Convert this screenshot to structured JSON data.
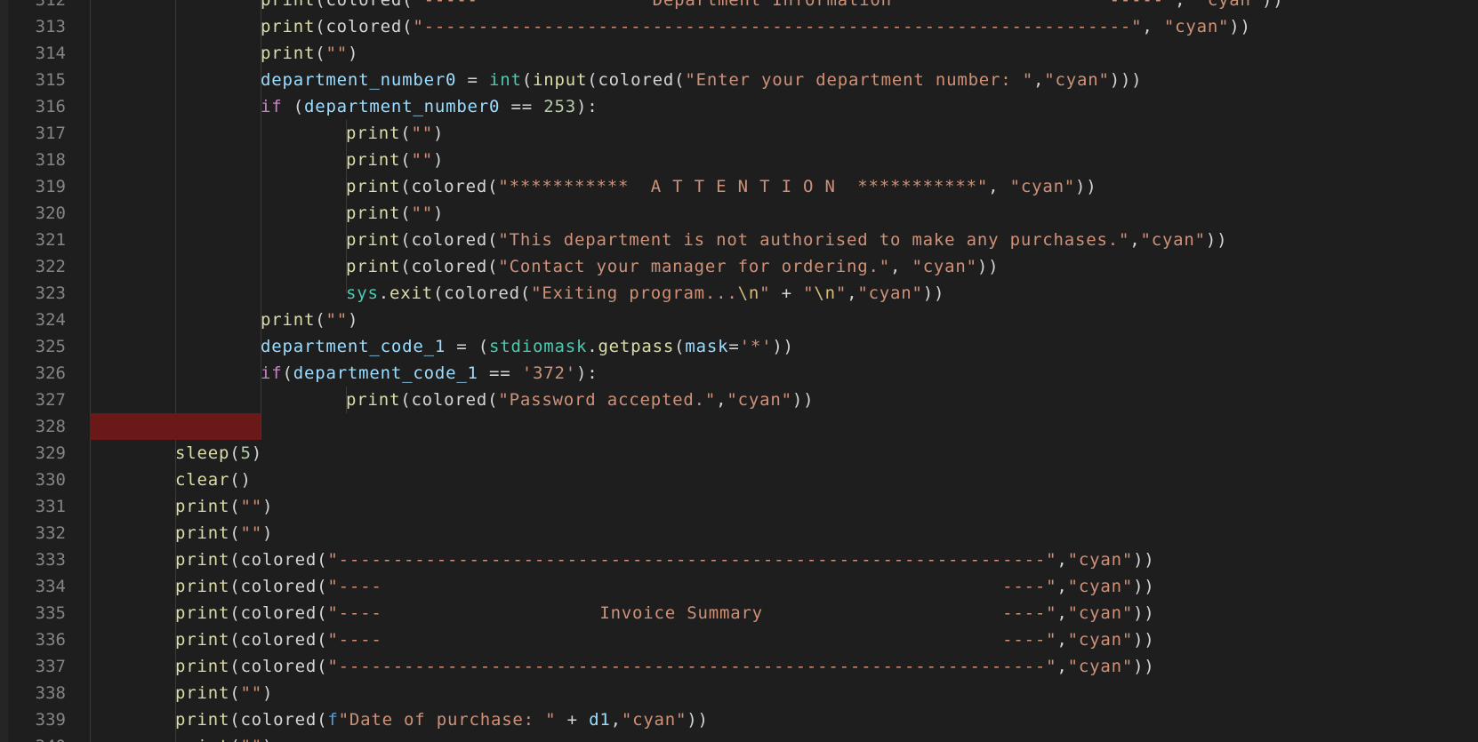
{
  "editor": {
    "colors": {
      "background": "#1e1e1e",
      "line_number": "#858585",
      "string": "#ce9178",
      "keyword": "#c586c0",
      "variable": "#9cdcfe",
      "function": "#dcdcaa",
      "type": "#4ec9b0",
      "number": "#b5cea8",
      "error_highlight": "#6b1818"
    },
    "lines": [
      {
        "num": "312",
        "indent": 8,
        "tokens": [
          [
            "f",
            "print"
          ],
          [
            "p",
            "(colored("
          ],
          [
            "s",
            "\"-----                Department Information                    -----\""
          ],
          [
            "p",
            ", "
          ],
          [
            "s",
            "\"cyan\""
          ],
          [
            "p",
            "))"
          ]
        ]
      },
      {
        "num": "313",
        "indent": 8,
        "tokens": [
          [
            "f",
            "print"
          ],
          [
            "p",
            "(colored("
          ],
          [
            "s",
            "\"-----------------------------------------------------------------\""
          ],
          [
            "p",
            ", "
          ],
          [
            "s",
            "\"cyan\""
          ],
          [
            "p",
            "))"
          ]
        ]
      },
      {
        "num": "314",
        "indent": 8,
        "tokens": [
          [
            "f",
            "print"
          ],
          [
            "p",
            "("
          ],
          [
            "s",
            "\"\""
          ],
          [
            "p",
            ")"
          ]
        ]
      },
      {
        "num": "315",
        "indent": 8,
        "tokens": [
          [
            "v",
            "department_number0"
          ],
          [
            "p",
            " = "
          ],
          [
            "t",
            "int"
          ],
          [
            "p",
            "("
          ],
          [
            "f",
            "input"
          ],
          [
            "p",
            "(colored("
          ],
          [
            "s",
            "\"Enter your department number: \""
          ],
          [
            "p",
            ","
          ],
          [
            "s",
            "\"cyan\""
          ],
          [
            "p",
            ")))"
          ]
        ]
      },
      {
        "num": "316",
        "indent": 8,
        "tokens": [
          [
            "k",
            "if"
          ],
          [
            "p",
            " ("
          ],
          [
            "v",
            "department_number0"
          ],
          [
            "p",
            " == "
          ],
          [
            "n",
            "253"
          ],
          [
            "p",
            "):"
          ]
        ]
      },
      {
        "num": "317",
        "indent": 12,
        "tokens": [
          [
            "f",
            "print"
          ],
          [
            "p",
            "("
          ],
          [
            "s",
            "\"\""
          ],
          [
            "p",
            ")"
          ]
        ]
      },
      {
        "num": "318",
        "indent": 12,
        "tokens": [
          [
            "f",
            "print"
          ],
          [
            "p",
            "("
          ],
          [
            "s",
            "\"\""
          ],
          [
            "p",
            ")"
          ]
        ]
      },
      {
        "num": "319",
        "indent": 12,
        "tokens": [
          [
            "f",
            "print"
          ],
          [
            "p",
            "(colored("
          ],
          [
            "s",
            "\"***********  A T T E N T I O N  ***********\""
          ],
          [
            "p",
            ", "
          ],
          [
            "s",
            "\"cyan\""
          ],
          [
            "p",
            "))"
          ]
        ]
      },
      {
        "num": "320",
        "indent": 12,
        "tokens": [
          [
            "f",
            "print"
          ],
          [
            "p",
            "("
          ],
          [
            "s",
            "\"\""
          ],
          [
            "p",
            ")"
          ]
        ]
      },
      {
        "num": "321",
        "indent": 12,
        "tokens": [
          [
            "f",
            "print"
          ],
          [
            "p",
            "(colored("
          ],
          [
            "s",
            "\"This department is not authorised to make any purchases.\""
          ],
          [
            "p",
            ","
          ],
          [
            "s",
            "\"cyan\""
          ],
          [
            "p",
            "))"
          ]
        ]
      },
      {
        "num": "322",
        "indent": 12,
        "tokens": [
          [
            "f",
            "print"
          ],
          [
            "p",
            "(colored("
          ],
          [
            "s",
            "\"Contact your manager for ordering.\""
          ],
          [
            "p",
            ", "
          ],
          [
            "s",
            "\"cyan\""
          ],
          [
            "p",
            "))"
          ]
        ]
      },
      {
        "num": "323",
        "indent": 12,
        "tokens": [
          [
            "t",
            "sys"
          ],
          [
            "p",
            "."
          ],
          [
            "f",
            "exit"
          ],
          [
            "p",
            "(colored("
          ],
          [
            "s",
            "\"Exiting program..."
          ],
          [
            "e",
            "\\n"
          ],
          [
            "s",
            "\""
          ],
          [
            "p",
            " + "
          ],
          [
            "s",
            "\""
          ],
          [
            "e",
            "\\n"
          ],
          [
            "s",
            "\""
          ],
          [
            "p",
            ","
          ],
          [
            "s",
            "\"cyan\""
          ],
          [
            "p",
            "))"
          ]
        ]
      },
      {
        "num": "324",
        "indent": 8,
        "tokens": [
          [
            "f",
            "print"
          ],
          [
            "p",
            "("
          ],
          [
            "s",
            "\"\""
          ],
          [
            "p",
            ")"
          ]
        ]
      },
      {
        "num": "325",
        "indent": 8,
        "tokens": [
          [
            "v",
            "department_code_1"
          ],
          [
            "p",
            " = ("
          ],
          [
            "t",
            "stdiomask"
          ],
          [
            "p",
            "."
          ],
          [
            "f",
            "getpass"
          ],
          [
            "p",
            "("
          ],
          [
            "v",
            "mask"
          ],
          [
            "p",
            "="
          ],
          [
            "s",
            "'*'"
          ],
          [
            "p",
            "))"
          ]
        ]
      },
      {
        "num": "326",
        "indent": 8,
        "tokens": [
          [
            "k",
            "if"
          ],
          [
            "p",
            "("
          ],
          [
            "v",
            "department_code_1"
          ],
          [
            "p",
            " == "
          ],
          [
            "s",
            "'372'"
          ],
          [
            "p",
            "):"
          ]
        ]
      },
      {
        "num": "327",
        "indent": 12,
        "tokens": [
          [
            "f",
            "print"
          ],
          [
            "p",
            "(colored("
          ],
          [
            "s",
            "\"Password accepted.\""
          ],
          [
            "p",
            ","
          ],
          [
            "s",
            "\"cyan\""
          ],
          [
            "p",
            "))"
          ]
        ]
      },
      {
        "num": "328",
        "indent": 0,
        "tokens": []
      },
      {
        "num": "329",
        "indent": 4,
        "tokens": [
          [
            "f",
            "sleep"
          ],
          [
            "p",
            "("
          ],
          [
            "n",
            "5"
          ],
          [
            "p",
            ")"
          ]
        ]
      },
      {
        "num": "330",
        "indent": 4,
        "tokens": [
          [
            "f",
            "clear"
          ],
          [
            "p",
            "()"
          ]
        ]
      },
      {
        "num": "331",
        "indent": 4,
        "tokens": [
          [
            "f",
            "print"
          ],
          [
            "p",
            "("
          ],
          [
            "s",
            "\"\""
          ],
          [
            "p",
            ")"
          ]
        ]
      },
      {
        "num": "332",
        "indent": 4,
        "tokens": [
          [
            "f",
            "print"
          ],
          [
            "p",
            "("
          ],
          [
            "s",
            "\"\""
          ],
          [
            "p",
            ")"
          ]
        ]
      },
      {
        "num": "333",
        "indent": 4,
        "tokens": [
          [
            "f",
            "print"
          ],
          [
            "p",
            "(colored("
          ],
          [
            "s",
            "\"-----------------------------------------------------------------\""
          ],
          [
            "p",
            ","
          ],
          [
            "s",
            "\"cyan\""
          ],
          [
            "p",
            "))"
          ]
        ]
      },
      {
        "num": "334",
        "indent": 4,
        "tokens": [
          [
            "f",
            "print"
          ],
          [
            "p",
            "(colored("
          ],
          [
            "s",
            "\"----                                                         ----\""
          ],
          [
            "p",
            ","
          ],
          [
            "s",
            "\"cyan\""
          ],
          [
            "p",
            "))"
          ]
        ]
      },
      {
        "num": "335",
        "indent": 4,
        "tokens": [
          [
            "f",
            "print"
          ],
          [
            "p",
            "(colored("
          ],
          [
            "s",
            "\"----                    Invoice Summary                      ----\""
          ],
          [
            "p",
            ","
          ],
          [
            "s",
            "\"cyan\""
          ],
          [
            "p",
            "))"
          ]
        ]
      },
      {
        "num": "336",
        "indent": 4,
        "tokens": [
          [
            "f",
            "print"
          ],
          [
            "p",
            "(colored("
          ],
          [
            "s",
            "\"----                                                         ----\""
          ],
          [
            "p",
            ","
          ],
          [
            "s",
            "\"cyan\""
          ],
          [
            "p",
            "))"
          ]
        ]
      },
      {
        "num": "337",
        "indent": 4,
        "tokens": [
          [
            "f",
            "print"
          ],
          [
            "p",
            "(colored("
          ],
          [
            "s",
            "\"-----------------------------------------------------------------\""
          ],
          [
            "p",
            ","
          ],
          [
            "s",
            "\"cyan\""
          ],
          [
            "p",
            "))"
          ]
        ]
      },
      {
        "num": "338",
        "indent": 4,
        "tokens": [
          [
            "f",
            "print"
          ],
          [
            "p",
            "("
          ],
          [
            "s",
            "\"\""
          ],
          [
            "p",
            ")"
          ]
        ]
      },
      {
        "num": "339",
        "indent": 4,
        "tokens": [
          [
            "f",
            "print"
          ],
          [
            "p",
            "(colored("
          ],
          [
            "bl",
            "f"
          ],
          [
            "s",
            "\"Date of purchase: \""
          ],
          [
            "p",
            " + "
          ],
          [
            "v",
            "d1"
          ],
          [
            "p",
            ","
          ],
          [
            "s",
            "\"cyan\""
          ],
          [
            "p",
            "))"
          ]
        ]
      },
      {
        "num": "340",
        "indent": 4,
        "tokens": [
          [
            "f",
            "print"
          ],
          [
            "p",
            "("
          ],
          [
            "s",
            "\"\""
          ],
          [
            "p",
            ")"
          ]
        ]
      }
    ]
  }
}
